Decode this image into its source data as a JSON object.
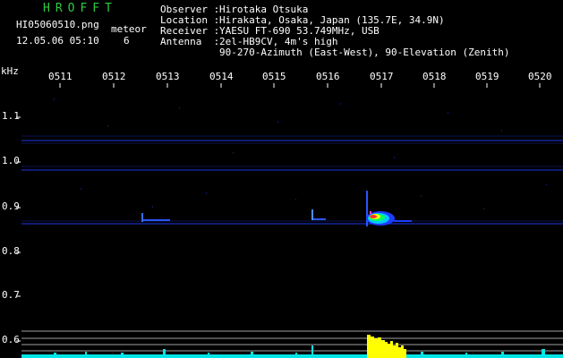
{
  "title": "HROFFT",
  "file": "HI05060510.png",
  "datetime": "12.05.06 05:10",
  "meteor_label": "meteor",
  "meteor_count": "6",
  "info": [
    {
      "label": "Observer : ",
      "value": "Hirotaka Otsuka"
    },
    {
      "label": "Location : ",
      "value": "Hirakata, Osaka, Japan (135.7E, 34.9N)"
    },
    {
      "label": "Receiver : ",
      "value": "YAESU FT-690 53.749MHz, USB"
    },
    {
      "label": "Antenna  : ",
      "value": "2el-HB9CV, 4m's high"
    },
    {
      "label": "",
      "value": "90-270-Azimuth (East-West), 90-Elevation (Zenith)"
    }
  ],
  "y_unit": "kHz",
  "time_ticks": [
    "0511",
    "0512",
    "0513",
    "0514",
    "0515",
    "0516",
    "0517",
    "0518",
    "0519",
    "0520"
  ],
  "freq_ticks": [
    "1.1",
    "1.0",
    "0.9",
    "0.8",
    "0.7",
    "0.6"
  ],
  "colors": {
    "background": "#000000",
    "title": "#2ecc40",
    "text": "#ffffff",
    "band": "#1e3cff",
    "noise": "#00e5e5",
    "signal_bar": "#ffff00",
    "baseline": "#a0a0a0"
  }
}
